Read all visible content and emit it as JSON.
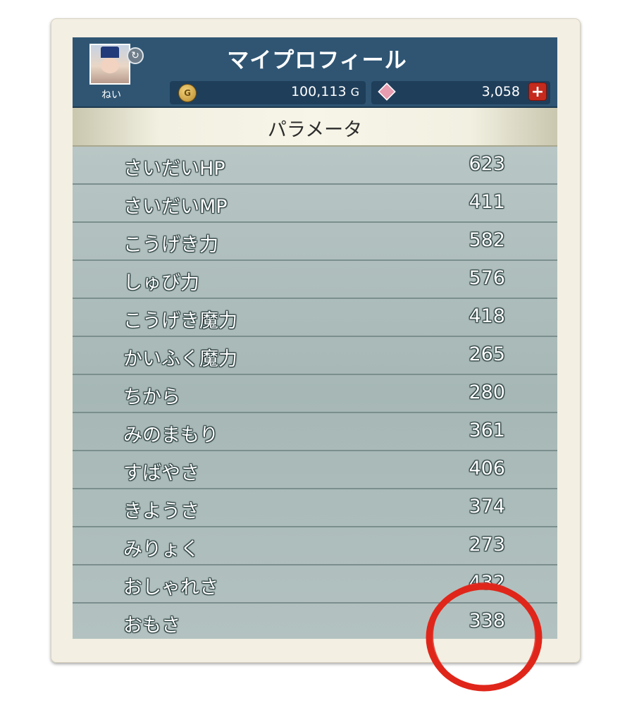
{
  "header": {
    "title": "マイプロフィール",
    "player_name": "ねい",
    "gold": "100,113",
    "gold_unit": "G",
    "gems": "3,058",
    "plus_label": "+",
    "coin_icon_letter": "G"
  },
  "section": {
    "title": "パラメータ"
  },
  "stats": [
    {
      "label": "さいだいHP",
      "value": "623"
    },
    {
      "label": "さいだいMP",
      "value": "411"
    },
    {
      "label": "こうげき力",
      "value": "582"
    },
    {
      "label": "しゅび力",
      "value": "576"
    },
    {
      "label": "こうげき魔力",
      "value": "418"
    },
    {
      "label": "かいふく魔力",
      "value": "265"
    },
    {
      "label": "ちから",
      "value": "280"
    },
    {
      "label": "みのまもり",
      "value": "361"
    },
    {
      "label": "すばやさ",
      "value": "406"
    },
    {
      "label": "きようさ",
      "value": "374"
    },
    {
      "label": "みりょく",
      "value": "273"
    },
    {
      "label": "おしゃれさ",
      "value": "432"
    },
    {
      "label": "おもさ",
      "value": "338"
    }
  ],
  "colors": {
    "header_bg": "#2f5573",
    "annotation_circle": "#e0261a",
    "plus_button": "#c52a1c"
  },
  "icons": [
    "avatar",
    "refresh-icon",
    "gold-coin-icon",
    "gem-icon",
    "plus-icon"
  ]
}
